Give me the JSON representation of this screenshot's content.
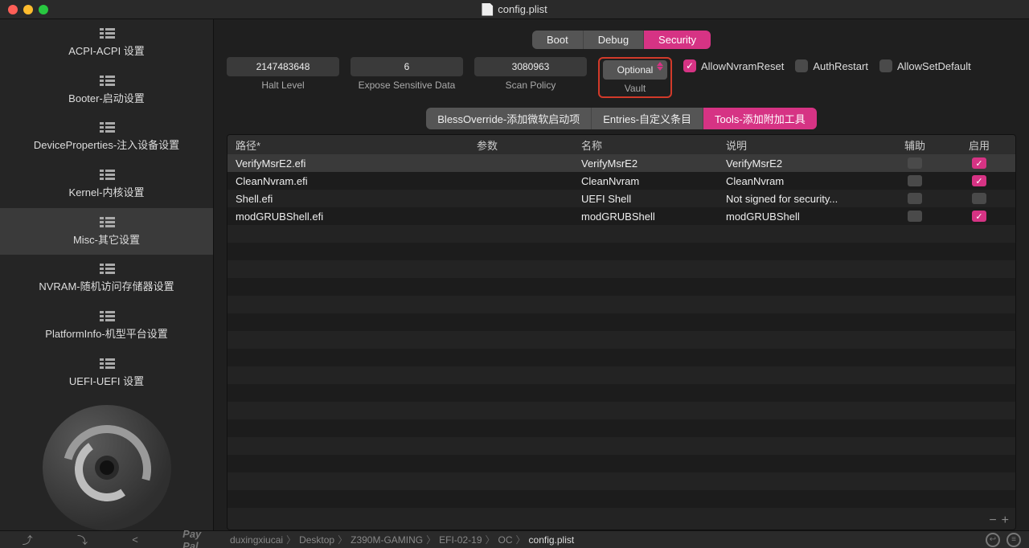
{
  "window": {
    "title": "config.plist"
  },
  "sidebar": {
    "items": [
      {
        "label": "ACPI-ACPI 设置"
      },
      {
        "label": "Booter-启动设置"
      },
      {
        "label": "DeviceProperties-注入设备设置"
      },
      {
        "label": "Kernel-内核设置"
      },
      {
        "label": "Misc-其它设置"
      },
      {
        "label": "NVRAM-随机访问存储器设置"
      },
      {
        "label": "PlatformInfo-机型平台设置"
      },
      {
        "label": "UEFI-UEFI 设置"
      }
    ],
    "activeIndex": 4
  },
  "topSegment": {
    "items": [
      "Boot",
      "Debug",
      "Security"
    ],
    "activeIndex": 2
  },
  "fields": {
    "halt": {
      "value": "2147483648",
      "label": "Halt Level"
    },
    "expose": {
      "value": "6",
      "label": "Expose Sensitive Data"
    },
    "scan": {
      "value": "3080963",
      "label": "Scan Policy"
    },
    "vault": {
      "value": "Optional",
      "label": "Vault"
    }
  },
  "checkboxes": {
    "allowNvramReset": {
      "label": "AllowNvramReset",
      "checked": true
    },
    "authRestart": {
      "label": "AuthRestart",
      "checked": false
    },
    "allowSetDefault": {
      "label": "AllowSetDefault",
      "checked": false
    }
  },
  "subTabs": {
    "items": [
      "BlessOverride-添加微软启动项",
      "Entries-自定义条目",
      "Tools-添加附加工具"
    ],
    "activeIndex": 2
  },
  "table": {
    "headers": {
      "path": "路径*",
      "args": "参数",
      "name": "名称",
      "desc": "说明",
      "aux": "辅助",
      "enable": "启用"
    },
    "rows": [
      {
        "path": "VerifyMsrE2.efi",
        "args": "",
        "name": "VerifyMsrE2",
        "desc": "VerifyMsrE2",
        "aux": false,
        "enable": true,
        "selected": true
      },
      {
        "path": "CleanNvram.efi",
        "args": "",
        "name": "CleanNvram",
        "desc": "CleanNvram",
        "aux": false,
        "enable": true,
        "selected": false
      },
      {
        "path": "Shell.efi",
        "args": "",
        "name": "UEFI Shell",
        "desc": "Not signed for security...",
        "aux": false,
        "enable": false,
        "selected": false
      },
      {
        "path": "modGRUBShell.efi",
        "args": "",
        "name": "modGRUBShell",
        "desc": "modGRUBShell",
        "aux": false,
        "enable": true,
        "selected": false
      }
    ]
  },
  "breadcrumbs": [
    "duxingxiucai",
    "Desktop",
    "Z390M-GAMING",
    "EFI-02-19",
    "OC",
    "config.plist"
  ]
}
